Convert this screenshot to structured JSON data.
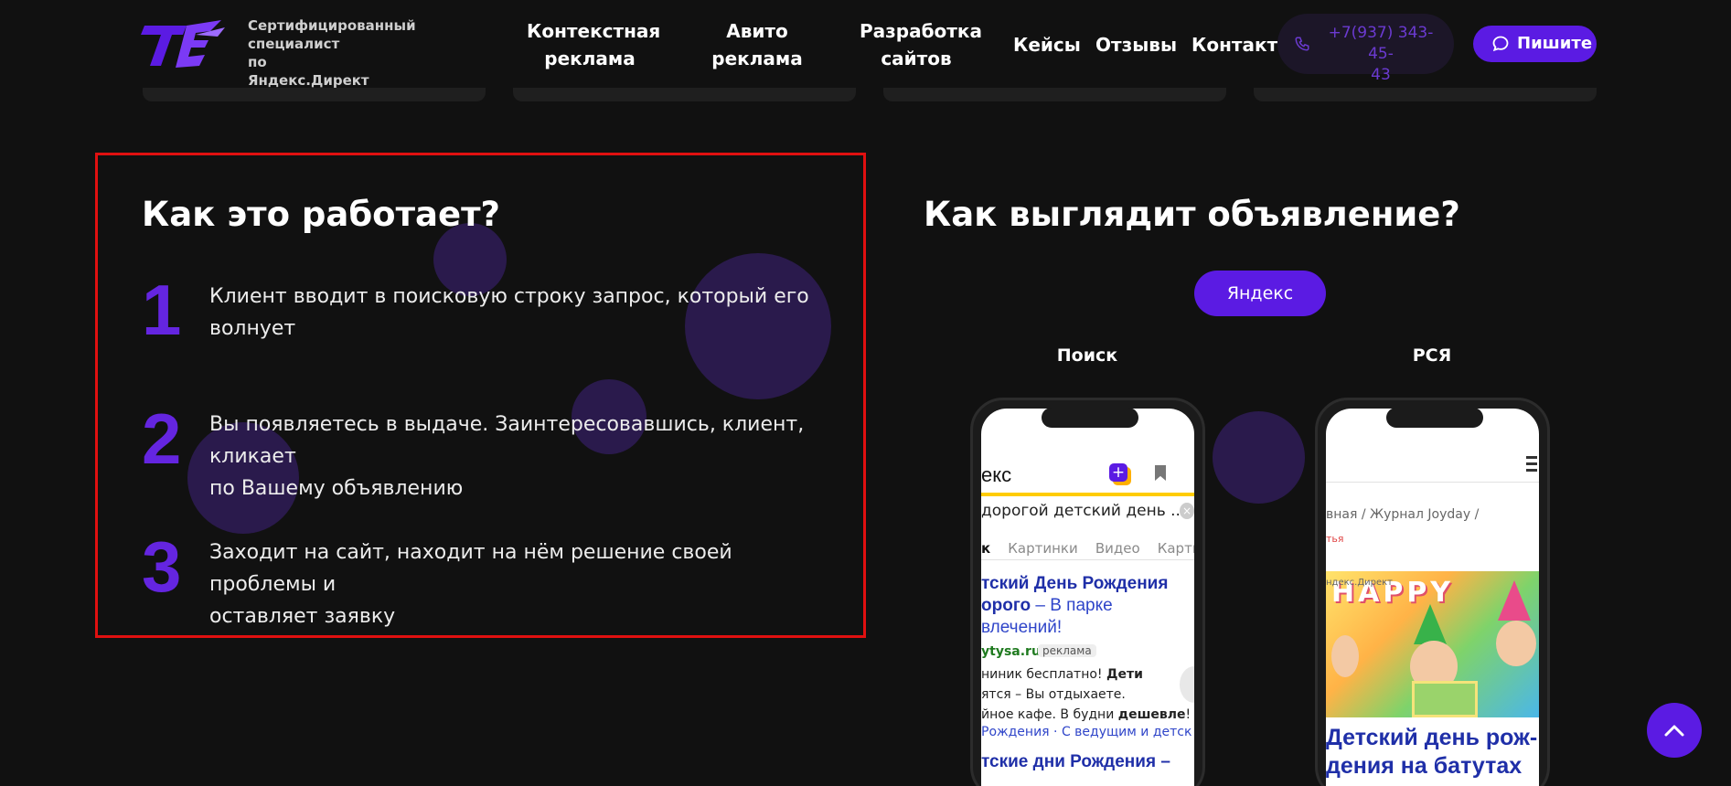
{
  "header": {
    "logo_text": "TE",
    "tagline_line1": "Сертифицированный специалист",
    "tagline_line2": "по",
    "tagline_line3": "Яндекс.Директ",
    "nav": [
      {
        "line1": "Контекстная",
        "line2": "реклама"
      },
      {
        "line1": "Авито",
        "line2": "реклама"
      },
      {
        "line1": "Разработка",
        "line2": "сайтов"
      },
      {
        "line1": "Кейсы",
        "line2": ""
      },
      {
        "line1": "Отзывы",
        "line2": ""
      },
      {
        "line1": "Контакты",
        "line2": ""
      }
    ],
    "phone_line1": "+7(937) 343-45-",
    "phone_line2": "43",
    "write_label": "Пишите"
  },
  "how_it_works": {
    "title": "Как это работает?",
    "steps": [
      {
        "num": "1",
        "line1": "Клиент вводит в поисковую строку запрос, который его",
        "line2": "волнует"
      },
      {
        "num": "2",
        "line1": "Вы появляетесь в выдаче. Заинтересовавшись, клиент, кликает",
        "line2": "по Вашему объявлению"
      },
      {
        "num": "3",
        "line1": "Заходит на сайт, находит на нём решение своей проблемы и",
        "line2": "оставляет заявку"
      }
    ]
  },
  "ad_preview": {
    "title": "Как выглядит объявление?",
    "tab_label": "Яндекс",
    "search_label": "Поиск",
    "rsya_label": "РСЯ",
    "search_screen": {
      "logo": "екс",
      "query": "дорогой детский день ...",
      "tabs": [
        "к",
        "Картинки",
        "Видео",
        "Карты"
      ],
      "ad_title_bold": "тский День Рождения",
      "ad_title_bold2": "орого",
      "ad_title_light": " – В парке",
      "ad_title_light2": "влечений!",
      "url": "ytysa.ru",
      "badge": "реклама",
      "snippet1": "ниник бесплатно! ",
      "snippet1_bold": "Дети",
      "snippet2": "ятся – Вы отдыхаете.",
      "snippet3": "йное кафе. В будни ",
      "snippet3_bold": "дешевле",
      "snippet3_end": "!",
      "sitelinks": "Рождения  ·  С ведущим и детск",
      "ad2_title": "тские дни Рождения –"
    },
    "rsya_screen": {
      "crumbs": "вная  /     Журнал Joyday  /",
      "tag": "тья",
      "source": "ндекс.Директ",
      "image_letters": "HAPPY",
      "title_line1": "Детский день рож-",
      "title_line2": "дения на батутах"
    }
  },
  "colors": {
    "background": "#111111",
    "accent": "#5b1be3",
    "step_number": "#6425e0",
    "highlight_frame": "#e01010"
  },
  "icons": [
    "phone-icon",
    "chat-bubble-icon",
    "chevron-up-icon",
    "plus-icon",
    "bookmark-icon",
    "close-icon",
    "menu-icon"
  ]
}
